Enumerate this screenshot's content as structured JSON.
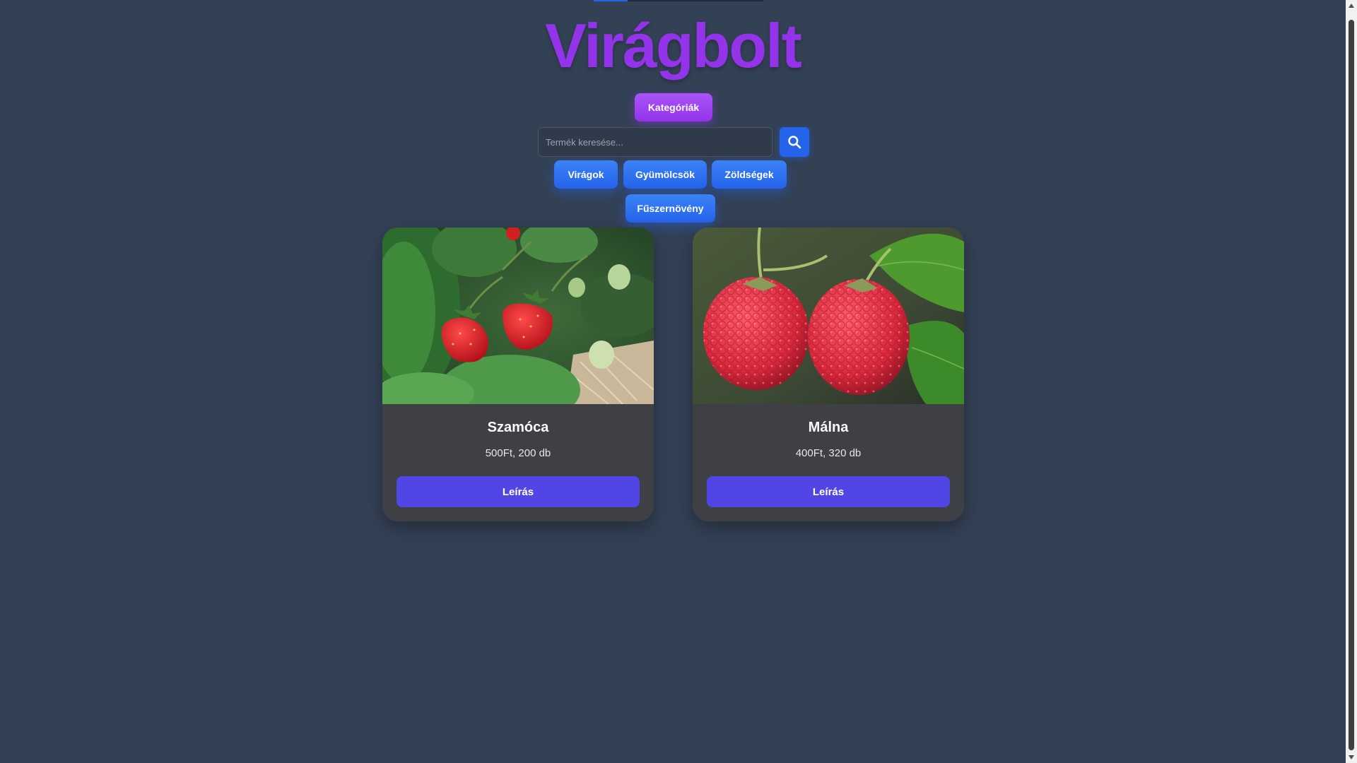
{
  "header": {
    "title": "Virágbolt",
    "categories_label": "Kategóriák"
  },
  "search": {
    "placeholder": "Termék keresése..."
  },
  "category_buttons": [
    {
      "label": "Virágok"
    },
    {
      "label": "Gyümölcsök"
    },
    {
      "label": "Zöldségek"
    },
    {
      "label": "Fűszernövény"
    }
  ],
  "products": [
    {
      "name": "Szamóca",
      "meta": "500Ft, 200 db",
      "button_label": "Leírás"
    },
    {
      "name": "Málna",
      "meta": "400Ft, 320 db",
      "button_label": "Leírás"
    }
  ],
  "colors": {
    "background": "#334155",
    "title": "#9333ea",
    "category_accent": "#9333ea",
    "filter_button": "#2563eb",
    "card_bg": "#3f3f46",
    "card_button": "#4f46e5"
  },
  "icons": {
    "search": "search-icon"
  }
}
